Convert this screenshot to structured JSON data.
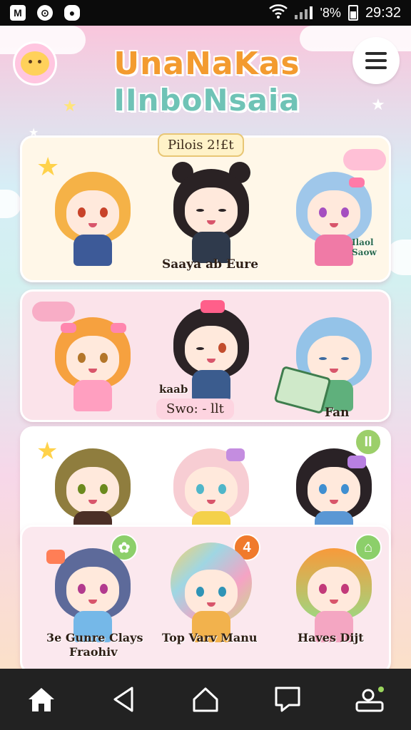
{
  "status_bar": {
    "left_icons": [
      "M",
      "⊙",
      "●"
    ],
    "battery_text": "'8%",
    "time": "29:32"
  },
  "header": {
    "title_line1": "UnaNaKas",
    "title_line2": "IInboNsaia",
    "menu_icon": "hamburger-menu-icon"
  },
  "section1": {
    "pill": "Pilois 2!£t",
    "caption": "Saaya ab Eure",
    "side_text": "Ilaol Saow"
  },
  "section2": {
    "tag_left": "kaab",
    "tag_center": "Swo: - llt",
    "tag_right": "Fan"
  },
  "section3": {
    "badge": "II"
  },
  "section4": {
    "label_left_1": "3e Gunre Clays",
    "label_left_2": "Fraohiv",
    "label_center": "Top Varv Manu",
    "label_right": "Haves Dijt",
    "badge_left": "✿",
    "badge_center": "4",
    "badge_right": "⌂"
  },
  "nav": {
    "items": [
      "home-icon",
      "back-icon",
      "home-outline-icon",
      "message-icon",
      "account-icon"
    ]
  },
  "colors": {
    "title_orange": "#f39b2f",
    "title_teal": "#6fc3b6",
    "nav_bg": "#222222"
  }
}
